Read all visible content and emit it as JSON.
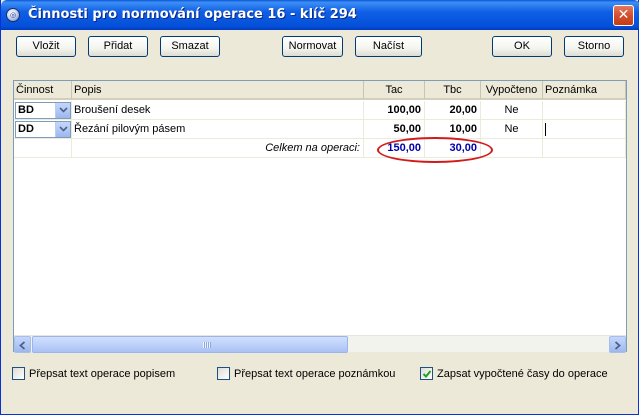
{
  "window": {
    "title": "Činnosti pro normování operace 16 - klíč 294",
    "icon": "app-icon",
    "close_symbol": "✕"
  },
  "toolbar": {
    "insert_label": "Vložit",
    "add_label": "Přidat",
    "delete_label": "Smazat",
    "normalize_label": "Normovat",
    "load_label": "Načíst",
    "ok_label": "OK",
    "cancel_label": "Storno"
  },
  "grid": {
    "columns": [
      "Činnost",
      "Popis",
      "Tac",
      "Tbc",
      "Vypočteno",
      "Poznámka"
    ],
    "rows": [
      {
        "cinnost": "BD",
        "popis": "Broušení desek",
        "tac": "100,00",
        "tbc": "20,00",
        "vypocteno": "Ne",
        "poznamka": ""
      },
      {
        "cinnost": "DD",
        "popis": "Řezání pilovým pásem",
        "tac": "50,00",
        "tbc": "10,00",
        "vypocteno": "Ne",
        "poznamka": ""
      }
    ],
    "total": {
      "label": "Celkem na operaci:",
      "tac": "150,00",
      "tbc": "30,00"
    }
  },
  "options": {
    "rewrite_desc_label": "Přepsat text operace popisem",
    "rewrite_desc_checked": false,
    "rewrite_note_label": "Přepsat text operace poznámkou",
    "rewrite_note_checked": false,
    "write_times_label": "Zapsat vypočtené časy do operace",
    "write_times_checked": true
  },
  "colors": {
    "title_bar": "#0450d8",
    "total_values": "#0000aa",
    "highlight_ellipse": "#d11b1b"
  }
}
